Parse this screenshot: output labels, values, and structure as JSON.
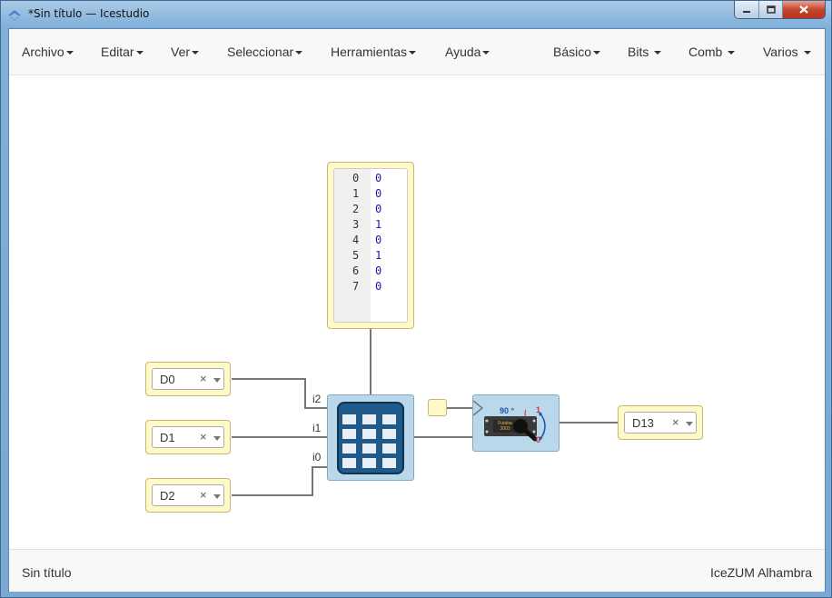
{
  "window": {
    "title": "*Sin título — Icestudio"
  },
  "menubar": {
    "left": [
      "Archivo",
      "Editar",
      "Ver",
      "Seleccionar",
      "Herramientas",
      "Ayuda"
    ],
    "right": [
      "Básico",
      "Bits",
      "Comb",
      "Varios"
    ]
  },
  "canvas": {
    "inputs": [
      {
        "label": "D0",
        "clear": "×"
      },
      {
        "label": "D1",
        "clear": "×"
      },
      {
        "label": "D2",
        "clear": "×"
      }
    ],
    "output": {
      "label": "D13",
      "clear": "×"
    },
    "memory": {
      "lines": [
        "0",
        "1",
        "2",
        "3",
        "4",
        "5",
        "6",
        "7"
      ],
      "values": [
        "0",
        "0",
        "0",
        "1",
        "0",
        "1",
        "0",
        "0"
      ]
    },
    "ports": [
      "i2",
      "i1",
      "i0"
    ],
    "servo_angle": "90 °",
    "servo_high": "1",
    "servo_low": "0",
    "servo_brand": "Futaba 3003"
  },
  "footer": {
    "file": "Sin título",
    "board": "IceZUM Alhambra"
  }
}
